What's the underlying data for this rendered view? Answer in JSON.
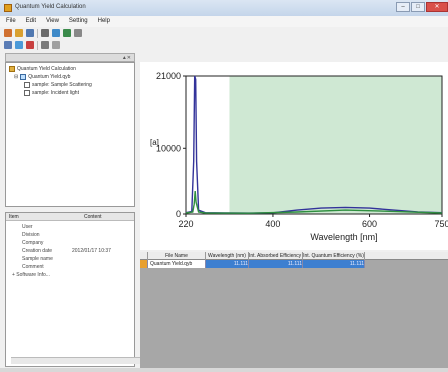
{
  "window": {
    "title": "Quantum Yield Calculation"
  },
  "menu": [
    "File",
    "Edit",
    "View",
    "Setting",
    "Help"
  ],
  "tree": {
    "root": "Quantum Yield Calculation",
    "group": "Quantum Yield.qyb",
    "items": [
      "sample: Sample Scattering",
      "sample: Incident light"
    ]
  },
  "props": {
    "headers": [
      "Item",
      "Content"
    ],
    "rows": [
      {
        "k": "User",
        "v": ""
      },
      {
        "k": "Division",
        "v": ""
      },
      {
        "k": "Company",
        "v": ""
      },
      {
        "k": "Creation date",
        "v": "2012/01/17 10:37"
      },
      {
        "k": "Sample name",
        "v": ""
      },
      {
        "k": "Comment",
        "v": ""
      },
      {
        "k": "+ Software Info...",
        "v": ""
      }
    ]
  },
  "chart_data": {
    "type": "line",
    "xlabel": "Wavelength [nm]",
    "ylabel": "[a]",
    "x_ticks": [
      "220",
      "400",
      "600",
      "750"
    ],
    "y_ticks": [
      "0",
      "10000",
      "21000"
    ],
    "xlim": [
      220,
      750
    ],
    "ylim": [
      0,
      21000
    ],
    "shaded_region": [
      310,
      750
    ],
    "series": [
      {
        "points": [
          [
            220,
            200
          ],
          [
            232,
            400
          ],
          [
            236,
            8000
          ],
          [
            238,
            21000
          ],
          [
            240,
            20500
          ],
          [
            242,
            8000
          ],
          [
            246,
            600
          ],
          [
            260,
            200
          ],
          [
            300,
            150
          ],
          [
            350,
            130
          ],
          [
            400,
            180
          ],
          [
            450,
            600
          ],
          [
            500,
            900
          ],
          [
            550,
            1000
          ],
          [
            600,
            900
          ],
          [
            650,
            600
          ],
          [
            700,
            300
          ],
          [
            750,
            200
          ]
        ],
        "color": "#33339a"
      },
      {
        "points": [
          [
            220,
            150
          ],
          [
            234,
            300
          ],
          [
            237,
            1500
          ],
          [
            239,
            3500
          ],
          [
            241,
            1800
          ],
          [
            246,
            300
          ],
          [
            260,
            150
          ],
          [
            350,
            120
          ],
          [
            450,
            300
          ],
          [
            550,
            600
          ],
          [
            650,
            400
          ],
          [
            750,
            150
          ]
        ],
        "color": "#2f8f3f"
      }
    ],
    "shade_color": "#cfe8d3"
  },
  "grid": {
    "headers": [
      "File Name",
      "Wavelength (nm)",
      "Int. Absorbed Efficiency (%)",
      "Int. Quantum Efficiency (%)"
    ],
    "row": [
      "Quantum Yield.qyb",
      "11.111",
      "11.111",
      "11.111"
    ]
  }
}
